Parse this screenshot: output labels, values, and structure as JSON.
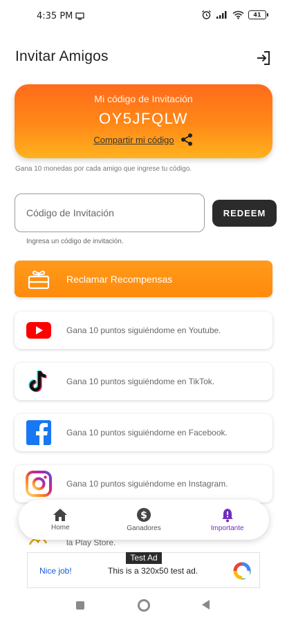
{
  "status_bar": {
    "time": "4:35 PM",
    "battery": "41"
  },
  "header": {
    "title": "Invitar Amigos"
  },
  "invite": {
    "label": "Mi código de Invitación",
    "code": "OY5JFQLW",
    "share_label": "Compartir mi código",
    "hint": "Gana 10 monedas por cada amigo que ingrese tu código."
  },
  "redeem": {
    "placeholder": "Código de Invitación",
    "button_label": "REDEEM",
    "hint": "Ingresa un código de invitación."
  },
  "claim": {
    "label": "Reclamar Recompensas"
  },
  "social": [
    {
      "icon": "youtube-icon",
      "text": "Gana 10 puntos siguiéndome en Youtube."
    },
    {
      "icon": "tiktok-icon",
      "text": "Gana 10 puntos siguiéndome en TikTok."
    },
    {
      "icon": "facebook-icon",
      "text": "Gana 10 puntos siguiéndome en Facebook."
    },
    {
      "icon": "instagram-icon",
      "text": "Gana 10 puntos siguiéndome en Instagram."
    }
  ],
  "partial_item": {
    "text": "la Play Store."
  },
  "bottom_nav": [
    {
      "label": "Home",
      "icon": "home-icon",
      "active": false
    },
    {
      "label": "Ganadores",
      "icon": "dollar-icon",
      "active": false
    },
    {
      "label": "Importante",
      "icon": "bell-icon",
      "active": true
    }
  ],
  "ad": {
    "badge": "Test Ad",
    "nice_job": "Nice job!",
    "text": "This is a 320x50 test ad."
  },
  "colors": {
    "accent_orange": "#ff8a0c",
    "redeem_dark": "#2b2b2b",
    "nav_active": "#6f2dbd"
  }
}
